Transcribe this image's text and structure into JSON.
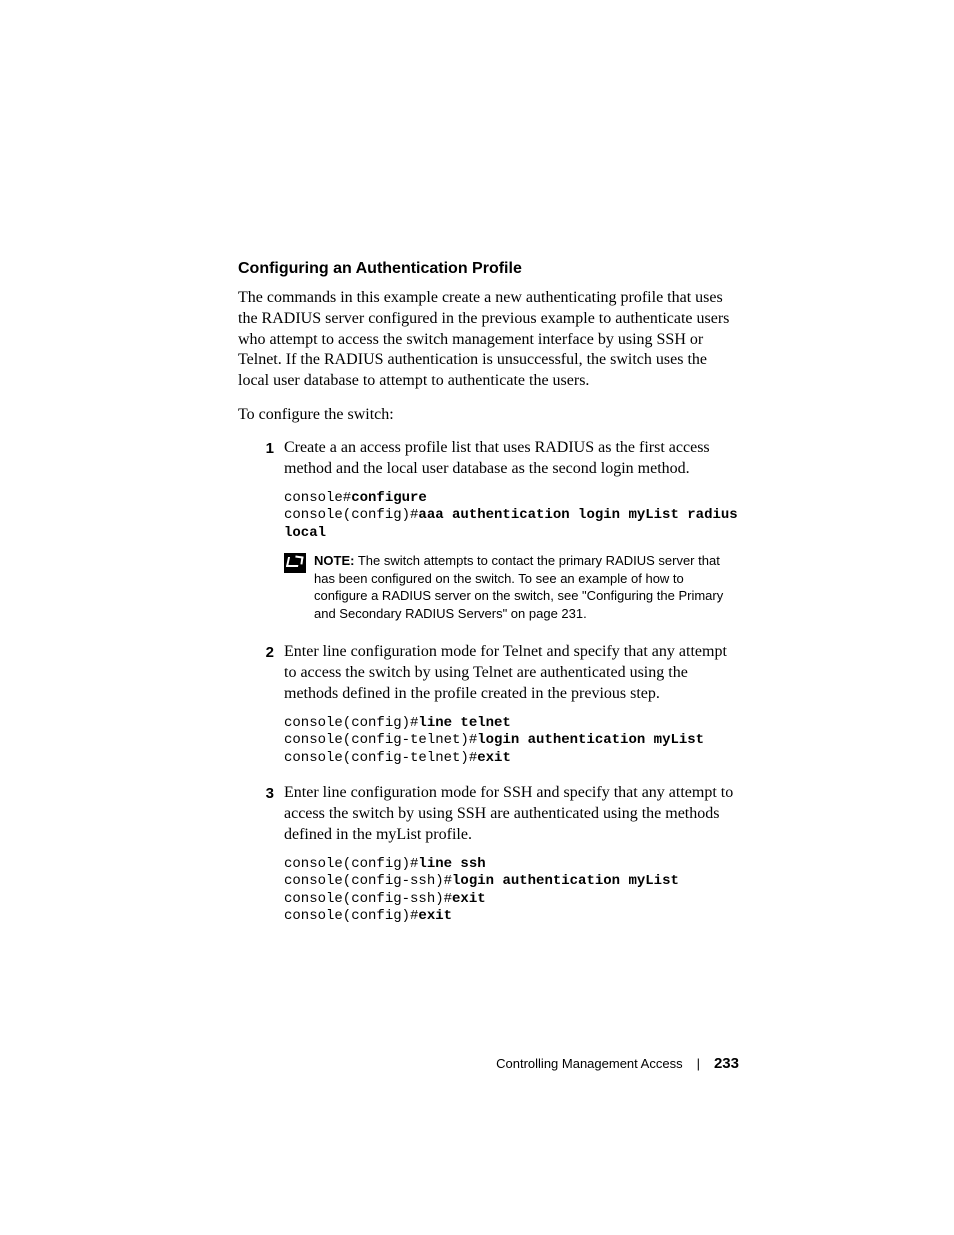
{
  "heading": "Configuring an Authentication Profile",
  "intro": "The commands in this example create a new authenticating profile that uses the RADIUS server configured in the previous example to authenticate users who attempt to access the switch management interface by using SSH or Telnet. If the RADIUS authentication is unsuccessful, the switch uses the local user database to attempt to authenticate the users.",
  "lead": "To configure the switch:",
  "steps": [
    {
      "num": "1",
      "text": "Create a an access profile list that uses RADIUS as the first access method and the local user database as the second login method.",
      "code": [
        {
          "prefix": "console#",
          "cmd": "configure"
        },
        {
          "prefix": "console(config)#",
          "cmd": "aaa authentication login myList radius local"
        }
      ],
      "note": "The switch attempts to contact the primary RADIUS server that has been configured on the switch. To see an example of how to configure a RADIUS server on the switch, see \"Configuring the Primary and Secondary RADIUS Servers\" on page 231."
    },
    {
      "num": "2",
      "text": "Enter line configuration mode for Telnet and specify that any attempt to access the switch by using Telnet are authenticated using the methods defined in the profile created in the previous step.",
      "code": [
        {
          "prefix": "console(config)#",
          "cmd": "line telnet"
        },
        {
          "prefix": "console(config-telnet)#",
          "cmd": "login authentication myList"
        },
        {
          "prefix": "console(config-telnet)#",
          "cmd": "exit"
        }
      ]
    },
    {
      "num": "3",
      "text": "Enter line configuration mode for SSH and specify that any attempt to access the switch by using SSH are authenticated using the methods defined in the myList profile.",
      "code": [
        {
          "prefix": "console(config)#",
          "cmd": "line ssh"
        },
        {
          "prefix": "console(config-ssh)#",
          "cmd": "login authentication myList"
        },
        {
          "prefix": "console(config-ssh)#",
          "cmd": "exit"
        },
        {
          "prefix": "console(config)#",
          "cmd": "exit"
        }
      ]
    }
  ],
  "note_label": "NOTE:",
  "footer": {
    "title": "Controlling Management Access",
    "page": "233"
  }
}
